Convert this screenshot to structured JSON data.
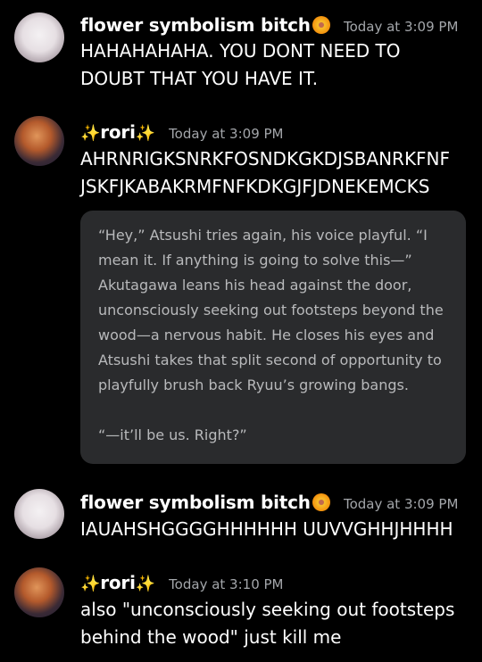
{
  "messages": [
    {
      "author": "flower symbolism bitch",
      "author_emoji": "blossom-emoji",
      "timestamp": "Today at 3:09 PM",
      "lines": [
        "HAHAHAHAHA. YOU DONT NEED TO",
        "DOUBT THAT YOU HAVE IT."
      ]
    },
    {
      "author": "rori",
      "author_prefix": "✨",
      "author_suffix": "✨",
      "timestamp": "Today at 3:09 PM",
      "lines": [
        "AHRNRIGKSNRKFOSNDKGKDJSBANRKFNF",
        "JSKFJKABAKRMFNFKDKGJFJDNEKEMCKS"
      ],
      "attachment": {
        "paragraph1": "“Hey,” Atsushi tries again, his voice playful. “I mean it. If anything is going to solve this—” Akutagawa leans his head against the door, unconsciously seeking out footsteps beyond the wood—a nervous habit. He closes his eyes and Atsushi takes that split second of opportunity to playfully brush back Ryuu’s growing bangs.",
        "paragraph2": "“—it’ll be us. Right?”"
      }
    },
    {
      "author": "flower symbolism bitch",
      "author_emoji": "blossom-emoji",
      "timestamp": "Today at 3:09 PM",
      "lines": [
        "IAUAHSHGGGGHHHHHH UUVVGHHJHHHH"
      ]
    },
    {
      "author": "rori",
      "author_prefix": "✨",
      "author_suffix": "✨",
      "timestamp": "Today at 3:10 PM",
      "lines": [
        "also \"unconsciously seeking out footsteps",
        "behind the wood\" just kill me"
      ]
    }
  ],
  "colors": {
    "background": "#000000",
    "name": "#ffffff",
    "timestamp": "#a3a6aa",
    "attachment_bg": "#2a2b2d",
    "attachment_text": "#b8b9bb"
  }
}
